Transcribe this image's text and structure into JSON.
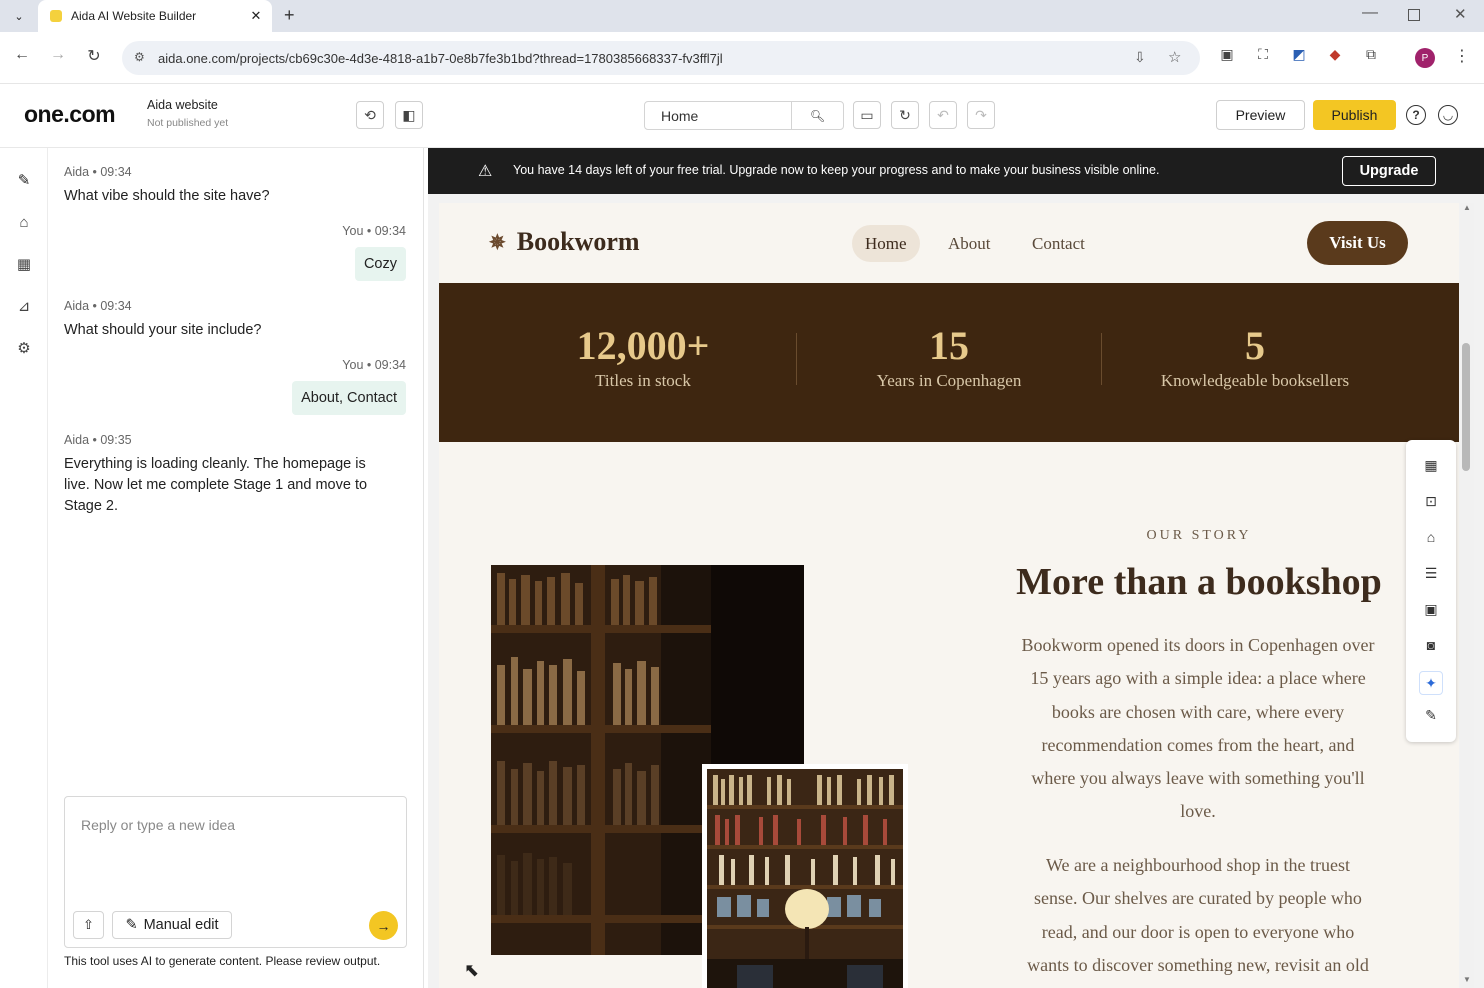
{
  "browser": {
    "tab_title": "Aida AI Website Builder",
    "url": "aida.one.com/projects/cb69c30e-4d3e-4818-a1b7-0e8b7fe3b1bd?thread=1780385668337-fv3ffl7jl"
  },
  "app": {
    "logo": "one.com",
    "site_name": "Aida website",
    "site_status": "Not published yet",
    "page_select": "Home",
    "preview_label": "Preview",
    "publish_label": "Publish"
  },
  "chat": {
    "messages": [
      {
        "author": "Aida",
        "time": "09:34",
        "meta": "Aida • 09:34",
        "text": "What vibe should the site have?"
      },
      {
        "author": "You",
        "time": "09:34",
        "meta": "You • 09:34",
        "text": "Cozy"
      },
      {
        "author": "Aida",
        "time": "09:34",
        "meta": "Aida • 09:34",
        "text": "What should your site include?"
      },
      {
        "author": "You",
        "time": "09:34",
        "meta": "You • 09:34",
        "text": "About, Contact"
      },
      {
        "author": "Aida",
        "time": "09:35",
        "meta": "Aida • 09:35",
        "text": "Everything is loading cleanly. The homepage is live. Now let me complete Stage 1 and move to Stage 2."
      }
    ],
    "placeholder": "Reply or type a new idea",
    "manual_edit_label": "Manual edit",
    "disclaimer": "This tool uses AI to generate content. Please review output."
  },
  "trial_banner": {
    "text": "You have 14 days left of your free trial. Upgrade now to keep your progress and to make your business visible online.",
    "upgrade_label": "Upgrade"
  },
  "site": {
    "brand": "Bookworm",
    "nav": [
      "Home",
      "About",
      "Contact"
    ],
    "cta": "Visit Us",
    "stats": [
      {
        "number": "12,000+",
        "label": "Titles in stock"
      },
      {
        "number": "15",
        "label": "Years in Copenhagen"
      },
      {
        "number": "5",
        "label": "Knowledgeable booksellers"
      }
    ],
    "story": {
      "eyebrow": "OUR STORY",
      "heading": "More than a bookshop",
      "p1_lines": [
        "Bookworm opened its doors in Copenhagen over",
        "15 years ago with a simple idea: a place where",
        "books are chosen with care, where every",
        "recommendation comes from the heart, and",
        "where you always leave with something you'll",
        "love."
      ],
      "p2_lines": [
        "We are a neighbourhood shop in the truest",
        "sense. Our shelves are curated by people who",
        "read, and our door is open to everyone who",
        "wants to discover something new, revisit an old"
      ]
    }
  },
  "colors": {
    "accent": "#f3c623",
    "stats_bg": "#3e2610",
    "cta_bg": "#5a3a1c",
    "site_bg": "#f8f5f0"
  }
}
